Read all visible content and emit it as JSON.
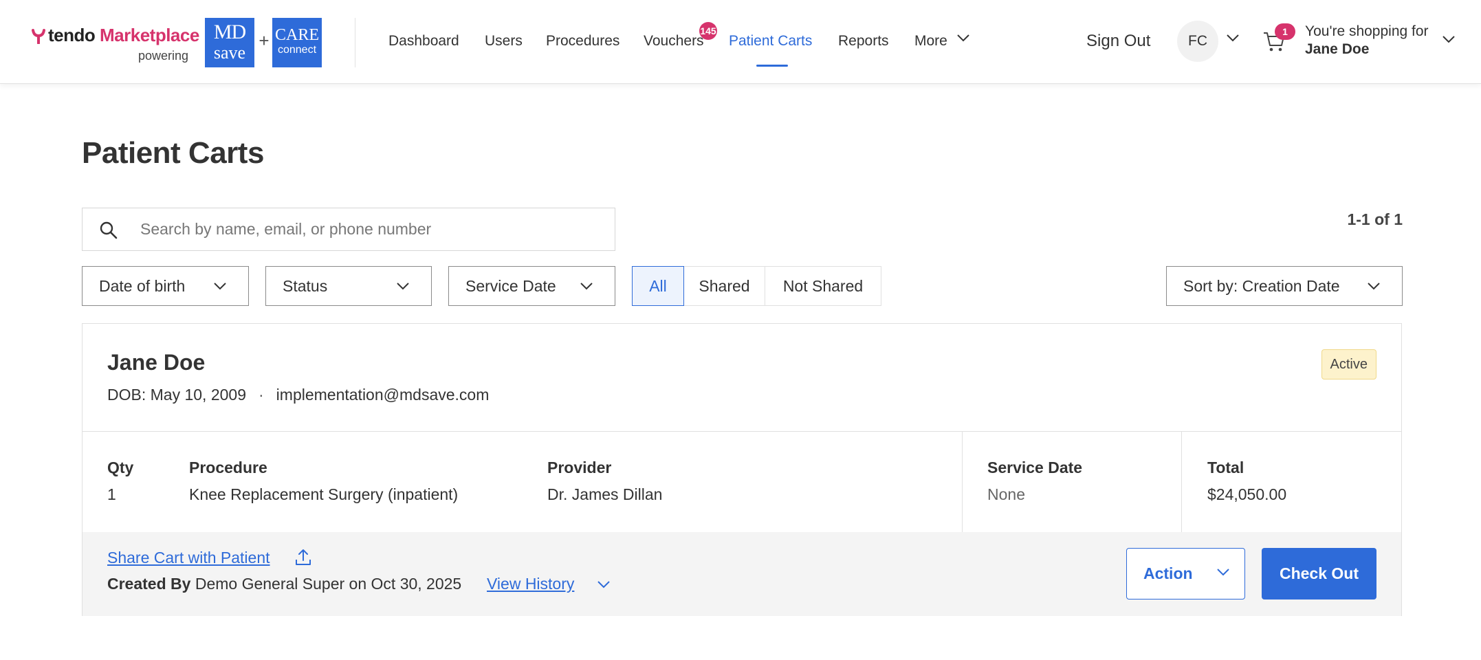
{
  "brand": {
    "name_part1": "tendo",
    "name_part2": "Marketplace",
    "powering": "powering",
    "partner1_line1": "MD",
    "partner1_line2": "save",
    "plus": "+",
    "partner2_line1": "CARE",
    "partner2_line2": "connect",
    "accent_color": "#2e6bd9",
    "brand_pink": "#d6336c"
  },
  "nav": {
    "items": [
      {
        "label": "Dashboard",
        "active": false
      },
      {
        "label": "Users",
        "active": false
      },
      {
        "label": "Procedures",
        "active": false
      },
      {
        "label": "Vouchers",
        "active": false,
        "badge": "145"
      },
      {
        "label": "Patient Carts",
        "active": true
      },
      {
        "label": "Reports",
        "active": false
      },
      {
        "label": "More",
        "active": false,
        "icon": "chevron-down-icon"
      }
    ]
  },
  "header_right": {
    "sign_out": "Sign Out",
    "avatar_initials": "FC",
    "cart_count": "1",
    "shopping_for_label": "You're shopping for",
    "shopping_for_name": "Jane Doe"
  },
  "page": {
    "title": "Patient Carts",
    "search_placeholder": "Search by name, email, or phone number",
    "search_value": "",
    "result_count": "1-1 of 1"
  },
  "filters": {
    "dob": "Date of birth",
    "status": "Status",
    "service_date": "Service Date",
    "segments": [
      "All",
      "Shared",
      "Not Shared"
    ],
    "segment_active": "All",
    "sort": "Sort by: Creation Date"
  },
  "cart": {
    "patient_name": "Jane Doe",
    "dob": "DOB: May 10, 2009",
    "separator": "·",
    "email": "implementation@mdsave.com",
    "status": "Active",
    "columns": {
      "qty_head": "Qty",
      "qty": "1",
      "procedure_head": "Procedure",
      "procedure": "Knee Replacement Surgery (inpatient)",
      "provider_head": "Provider",
      "provider": "Dr. James Dillan",
      "service_date_head": "Service Date",
      "service_date": "None",
      "total_head": "Total",
      "total": "$24,050.00"
    },
    "share_link": "Share Cart with Patient",
    "created_by_label": "Created By",
    "created_by_text": "Demo General Super on Oct 30, 2025",
    "view_history": "View History",
    "action_label": "Action",
    "checkout_label": "Check Out"
  }
}
